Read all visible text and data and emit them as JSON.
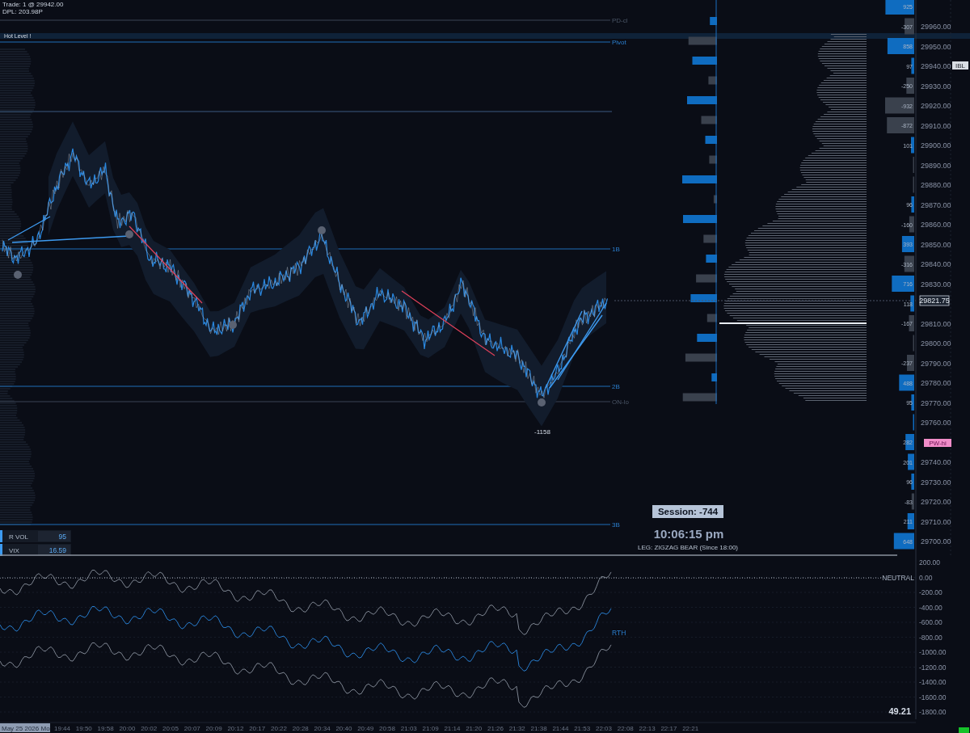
{
  "header": {
    "trade": "Trade: 1 @ 29942.00",
    "dpl": "DPL: 203.98P"
  },
  "hot_level": {
    "label": "Hot Level !"
  },
  "levels": [
    {
      "label": "PD-cl",
      "kind": "gray"
    },
    {
      "label": "Pivot",
      "kind": "blue"
    },
    {
      "label": "1B",
      "kind": "blue"
    },
    {
      "label": "2B",
      "kind": "blue"
    },
    {
      "label": "ON-lo",
      "kind": "gray"
    },
    {
      "label": "3B",
      "kind": "blue"
    }
  ],
  "delta_column": [
    {
      "label": "925",
      "kind": "buy",
      "level": 0.99
    },
    {
      "label": "-307",
      "kind": "sell",
      "level": 0.33
    },
    {
      "label": "858",
      "kind": "buy",
      "level": 0.92
    },
    {
      "label": "97",
      "kind": "buy",
      "level": 0.1
    },
    {
      "label": "-250",
      "kind": "sell",
      "level": 0.27
    },
    {
      "label": "-932",
      "kind": "sell",
      "level": 1.0
    },
    {
      "label": "-872",
      "kind": "sell",
      "level": 0.94
    },
    {
      "label": "101",
      "kind": "buy",
      "level": 0.11
    },
    {
      "kind": "sell",
      "level": 0.03
    },
    {
      "kind": "sell",
      "level": 0.03
    },
    {
      "label": "96",
      "kind": "buy",
      "level": 0.1
    },
    {
      "label": "-160",
      "kind": "sell",
      "level": 0.17
    },
    {
      "label": "393",
      "kind": "buy",
      "level": 0.42
    },
    {
      "label": "-316",
      "kind": "sell",
      "level": 0.34
    },
    {
      "label": "716",
      "kind": "buy",
      "level": 0.77
    },
    {
      "label": "118",
      "kind": "buy",
      "level": 0.13
    },
    {
      "label": "-167",
      "kind": "sell",
      "level": 0.18
    },
    {
      "kind": "sell",
      "level": 0.03
    },
    {
      "label": "-237",
      "kind": "sell",
      "level": 0.25
    },
    {
      "label": "488",
      "kind": "buy",
      "level": 0.52
    },
    {
      "label": "95",
      "kind": "buy",
      "level": 0.1
    },
    {
      "kind": "buy",
      "level": 0.03
    },
    {
      "label": "282",
      "kind": "buy",
      "level": 0.3
    },
    {
      "label": "201",
      "kind": "buy",
      "level": 0.22
    },
    {
      "label": "96",
      "kind": "buy",
      "level": 0.1
    },
    {
      "label": "-83",
      "kind": "sell",
      "level": 0.09
    },
    {
      "label": "211",
      "kind": "buy",
      "level": 0.23
    },
    {
      "label": "648",
      "kind": "buy",
      "level": 0.7
    }
  ],
  "price_axis": {
    "tick_groups": [
      [
        "29960.00",
        "29950.00",
        "29940.00",
        "29930.00",
        "29920.00",
        "29910.00",
        "29900.00",
        "29890.00",
        "29880.00",
        "29870.00",
        "29860.00",
        "29850.00",
        "29840.00",
        "29830.00"
      ],
      [
        "29810.00",
        "29800.00",
        "29790.00",
        "29780.00",
        "29770.00",
        "29760.00"
      ],
      [
        "29740.00",
        "29730.00",
        "29720.00",
        "29710.00",
        "29700.00"
      ]
    ],
    "tags": [
      {
        "label": "IBL",
        "kind": "ibl"
      },
      {
        "label": "PW-hi",
        "kind": "pw"
      }
    ],
    "last_price": "29821.75"
  },
  "overlay": {
    "swing_label": "-1158",
    "session": "Session: -744",
    "clock": "10:06:15 pm",
    "leg": "LEG: ZIGZAG BEAR (Since 18:00)"
  },
  "indicators": [
    {
      "label": "R VOL",
      "value": "95"
    },
    {
      "label": "VIX",
      "value": "16.59"
    }
  ],
  "lower_panel": {
    "ticks": [
      "200.00",
      "0.00",
      "-200.00",
      "-400.00",
      "-600.00",
      "-800.00",
      "-1000.00",
      "-1200.00",
      "-1400.00",
      "-1600.00",
      "-1800.00"
    ],
    "neutral": "NEUTRAL",
    "series_label": "RTH",
    "reading": "49.21"
  },
  "time_axis": {
    "date": "May 25 2026 Mo",
    "labels": [
      "19:44",
      "19:50",
      "19:58",
      "20:00",
      "20:02",
      "20:05",
      "20:07",
      "20:09",
      "20:12",
      "20:17",
      "20:22",
      "20:28",
      "20:34",
      "20:40",
      "20:49",
      "20:58",
      "21:03",
      "21:09",
      "21:14",
      "21:20",
      "21:26",
      "21:32",
      "21:38",
      "21:44",
      "21:53",
      "22:03",
      "22:08",
      "22:13",
      "22:17",
      "22:21"
    ]
  }
}
